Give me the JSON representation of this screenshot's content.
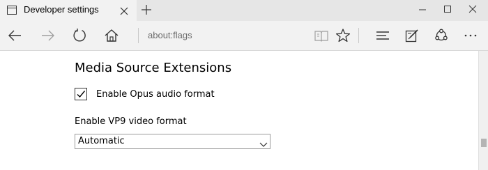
{
  "tab": {
    "title": "Developer settings",
    "icon": "page-icon"
  },
  "window_controls": [
    "minimize-icon",
    "maximize-icon",
    "close-icon"
  ],
  "navbar": {
    "address": "about:flags"
  },
  "content": {
    "section_title": "Media Source Extensions",
    "opus_checkbox": {
      "label": "Enable Opus audio format",
      "checked": true
    },
    "vp9": {
      "label": "Enable VP9 video format",
      "value": "Automatic"
    }
  },
  "scrollbar": {
    "position": 0.79
  },
  "colors": {
    "titlebar": "#e6e6e6",
    "toolbar": "#f2f2f2",
    "icon": "#333333",
    "disabled_icon": "#a0a0a0"
  }
}
